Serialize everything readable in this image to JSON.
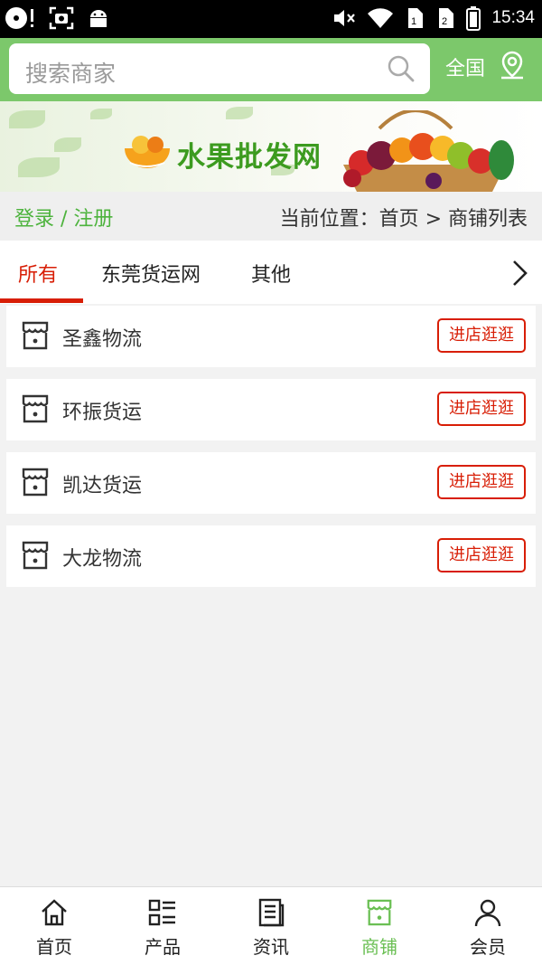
{
  "status_bar": {
    "time": "15:34",
    "icons": [
      "record-icon",
      "screenshot-icon",
      "android-icon",
      "mute-icon",
      "wifi-icon",
      "sim1-icon",
      "sim2-icon",
      "battery-icon"
    ]
  },
  "header": {
    "search_placeholder": "搜索商家",
    "region": "全国"
  },
  "banner": {
    "title": "水果批发网"
  },
  "breadcrumb": {
    "login": "登录 / 注册",
    "location": "当前位置：首页 > 商铺列表"
  },
  "tabs": [
    {
      "label": "所有",
      "active": true
    },
    {
      "label": "东莞货运网",
      "active": false
    },
    {
      "label": "其他",
      "active": false
    }
  ],
  "shops": [
    {
      "name": "圣鑫物流",
      "button": "进店逛逛"
    },
    {
      "name": "环振货运",
      "button": "进店逛逛"
    },
    {
      "name": "凯达货运",
      "button": "进店逛逛"
    },
    {
      "name": "大龙物流",
      "button": "进店逛逛"
    }
  ],
  "bottom_nav": [
    {
      "label": "首页",
      "icon": "home-icon",
      "active": false
    },
    {
      "label": "产品",
      "icon": "list-icon",
      "active": false
    },
    {
      "label": "资讯",
      "icon": "news-icon",
      "active": false
    },
    {
      "label": "商铺",
      "icon": "shop-icon",
      "active": true
    },
    {
      "label": "会员",
      "icon": "user-icon",
      "active": false
    }
  ],
  "colors": {
    "header_green": "#7cc86b",
    "accent_red": "#d81e06",
    "link_green": "#4db33d",
    "nav_active": "#6abf53"
  }
}
